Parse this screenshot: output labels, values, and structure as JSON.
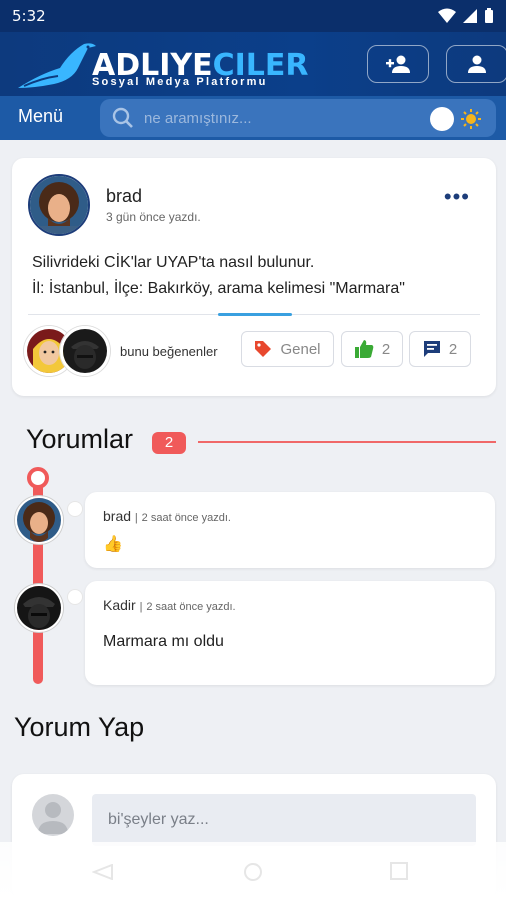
{
  "status": {
    "time": "5:32"
  },
  "header": {
    "brand_main": "ADLIYE",
    "brand_accent": "CILER",
    "tagline": "Sosyal Medya Platformu"
  },
  "nav": {
    "menu_label": "Menü",
    "search_placeholder": "ne aramıştınız..."
  },
  "post": {
    "author": "brad",
    "time": "3 gün önce yazdı.",
    "body_line1": "Silivrideki CİK'lar  UYAP'ta  nasıl bulunur.",
    "body_line2": "İl: İstanbul, İlçe: Bakırköy, arama kelimesi \"Marmara\"",
    "likers_label": "bunu beğenenler",
    "category": "Genel",
    "likes": "2",
    "comments": "2"
  },
  "comments_section": {
    "title": "Yorumlar",
    "count": "2"
  },
  "comments": [
    {
      "author": "brad",
      "time": "2 saat önce yazdı.",
      "body": "👍"
    },
    {
      "author": "Kadir",
      "time": "2 saat önce yazdı.",
      "body": "Marmara mı oldu"
    }
  ],
  "compose": {
    "title": "Yorum Yap",
    "placeholder": "bi'şeyler yaz..."
  },
  "colors": {
    "header": "#0d3a7e",
    "searchbar": "#1d5aa6",
    "accent_red": "#f05a5a",
    "accent_blue": "#39a0e0"
  }
}
